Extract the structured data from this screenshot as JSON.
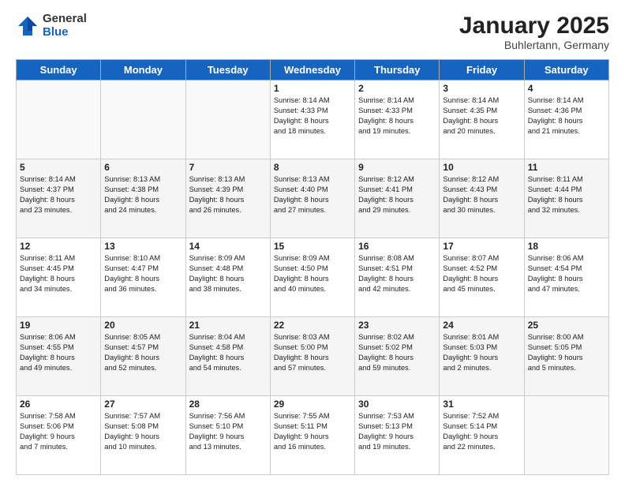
{
  "header": {
    "logo_general": "General",
    "logo_blue": "Blue",
    "month": "January 2025",
    "location": "Buhlertann, Germany"
  },
  "weekdays": [
    "Sunday",
    "Monday",
    "Tuesday",
    "Wednesday",
    "Thursday",
    "Friday",
    "Saturday"
  ],
  "weeks": [
    [
      {
        "day": "",
        "text": ""
      },
      {
        "day": "",
        "text": ""
      },
      {
        "day": "",
        "text": ""
      },
      {
        "day": "1",
        "text": "Sunrise: 8:14 AM\nSunset: 4:33 PM\nDaylight: 8 hours\nand 18 minutes."
      },
      {
        "day": "2",
        "text": "Sunrise: 8:14 AM\nSunset: 4:33 PM\nDaylight: 8 hours\nand 19 minutes."
      },
      {
        "day": "3",
        "text": "Sunrise: 8:14 AM\nSunset: 4:35 PM\nDaylight: 8 hours\nand 20 minutes."
      },
      {
        "day": "4",
        "text": "Sunrise: 8:14 AM\nSunset: 4:36 PM\nDaylight: 8 hours\nand 21 minutes."
      }
    ],
    [
      {
        "day": "5",
        "text": "Sunrise: 8:14 AM\nSunset: 4:37 PM\nDaylight: 8 hours\nand 23 minutes."
      },
      {
        "day": "6",
        "text": "Sunrise: 8:13 AM\nSunset: 4:38 PM\nDaylight: 8 hours\nand 24 minutes."
      },
      {
        "day": "7",
        "text": "Sunrise: 8:13 AM\nSunset: 4:39 PM\nDaylight: 8 hours\nand 26 minutes."
      },
      {
        "day": "8",
        "text": "Sunrise: 8:13 AM\nSunset: 4:40 PM\nDaylight: 8 hours\nand 27 minutes."
      },
      {
        "day": "9",
        "text": "Sunrise: 8:12 AM\nSunset: 4:41 PM\nDaylight: 8 hours\nand 29 minutes."
      },
      {
        "day": "10",
        "text": "Sunrise: 8:12 AM\nSunset: 4:43 PM\nDaylight: 8 hours\nand 30 minutes."
      },
      {
        "day": "11",
        "text": "Sunrise: 8:11 AM\nSunset: 4:44 PM\nDaylight: 8 hours\nand 32 minutes."
      }
    ],
    [
      {
        "day": "12",
        "text": "Sunrise: 8:11 AM\nSunset: 4:45 PM\nDaylight: 8 hours\nand 34 minutes."
      },
      {
        "day": "13",
        "text": "Sunrise: 8:10 AM\nSunset: 4:47 PM\nDaylight: 8 hours\nand 36 minutes."
      },
      {
        "day": "14",
        "text": "Sunrise: 8:09 AM\nSunset: 4:48 PM\nDaylight: 8 hours\nand 38 minutes."
      },
      {
        "day": "15",
        "text": "Sunrise: 8:09 AM\nSunset: 4:50 PM\nDaylight: 8 hours\nand 40 minutes."
      },
      {
        "day": "16",
        "text": "Sunrise: 8:08 AM\nSunset: 4:51 PM\nDaylight: 8 hours\nand 42 minutes."
      },
      {
        "day": "17",
        "text": "Sunrise: 8:07 AM\nSunset: 4:52 PM\nDaylight: 8 hours\nand 45 minutes."
      },
      {
        "day": "18",
        "text": "Sunrise: 8:06 AM\nSunset: 4:54 PM\nDaylight: 8 hours\nand 47 minutes."
      }
    ],
    [
      {
        "day": "19",
        "text": "Sunrise: 8:06 AM\nSunset: 4:55 PM\nDaylight: 8 hours\nand 49 minutes."
      },
      {
        "day": "20",
        "text": "Sunrise: 8:05 AM\nSunset: 4:57 PM\nDaylight: 8 hours\nand 52 minutes."
      },
      {
        "day": "21",
        "text": "Sunrise: 8:04 AM\nSunset: 4:58 PM\nDaylight: 8 hours\nand 54 minutes."
      },
      {
        "day": "22",
        "text": "Sunrise: 8:03 AM\nSunset: 5:00 PM\nDaylight: 8 hours\nand 57 minutes."
      },
      {
        "day": "23",
        "text": "Sunrise: 8:02 AM\nSunset: 5:02 PM\nDaylight: 8 hours\nand 59 minutes."
      },
      {
        "day": "24",
        "text": "Sunrise: 8:01 AM\nSunset: 5:03 PM\nDaylight: 9 hours\nand 2 minutes."
      },
      {
        "day": "25",
        "text": "Sunrise: 8:00 AM\nSunset: 5:05 PM\nDaylight: 9 hours\nand 5 minutes."
      }
    ],
    [
      {
        "day": "26",
        "text": "Sunrise: 7:58 AM\nSunset: 5:06 PM\nDaylight: 9 hours\nand 7 minutes."
      },
      {
        "day": "27",
        "text": "Sunrise: 7:57 AM\nSunset: 5:08 PM\nDaylight: 9 hours\nand 10 minutes."
      },
      {
        "day": "28",
        "text": "Sunrise: 7:56 AM\nSunset: 5:10 PM\nDaylight: 9 hours\nand 13 minutes."
      },
      {
        "day": "29",
        "text": "Sunrise: 7:55 AM\nSunset: 5:11 PM\nDaylight: 9 hours\nand 16 minutes."
      },
      {
        "day": "30",
        "text": "Sunrise: 7:53 AM\nSunset: 5:13 PM\nDaylight: 9 hours\nand 19 minutes."
      },
      {
        "day": "31",
        "text": "Sunrise: 7:52 AM\nSunset: 5:14 PM\nDaylight: 9 hours\nand 22 minutes."
      },
      {
        "day": "",
        "text": ""
      }
    ]
  ]
}
